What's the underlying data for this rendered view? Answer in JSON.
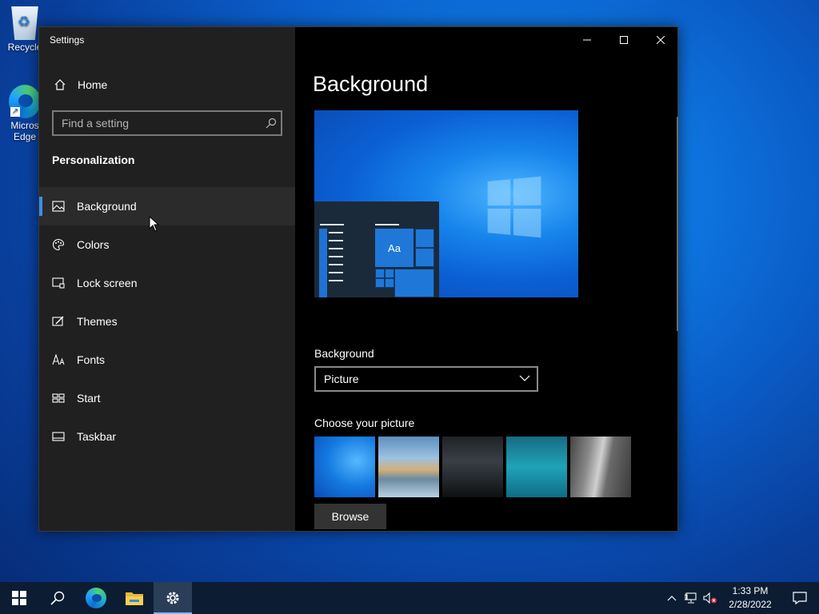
{
  "desktop": {
    "icons": [
      {
        "label": "Recycle",
        "icon": "recycle-bin-icon"
      },
      {
        "label": "Micros Edge",
        "icon": "edge-icon"
      }
    ]
  },
  "window": {
    "title": "Settings",
    "controls": {
      "minimize": "minimize-icon",
      "maximize": "maximize-icon",
      "close": "close-icon"
    }
  },
  "sidebar": {
    "home_label": "Home",
    "search_placeholder": "Find a setting",
    "section_title": "Personalization",
    "items": [
      {
        "label": "Background",
        "icon": "picture-icon",
        "active": true
      },
      {
        "label": "Colors",
        "icon": "palette-icon",
        "active": false
      },
      {
        "label": "Lock screen",
        "icon": "lock-screen-icon",
        "active": false
      },
      {
        "label": "Themes",
        "icon": "themes-icon",
        "active": false
      },
      {
        "label": "Fonts",
        "icon": "fonts-icon",
        "active": false
      },
      {
        "label": "Start",
        "icon": "start-icon",
        "active": false
      },
      {
        "label": "Taskbar",
        "icon": "taskbar-icon",
        "active": false
      }
    ]
  },
  "main": {
    "title": "Background",
    "preview_tile_text": "Aa",
    "background_label": "Background",
    "background_value": "Picture",
    "choose_label": "Choose your picture",
    "browse_label": "Browse"
  },
  "taskbar": {
    "time": "1:33 PM",
    "date": "2/28/2022",
    "apps": [
      "start-icon",
      "search-icon",
      "edge-icon",
      "file-explorer-icon",
      "settings-icon"
    ]
  },
  "colors": {
    "accent": "#3b8ee8",
    "sidebar_bg": "#202020",
    "window_bg": "#000000",
    "taskbar_bg": "#0c1d33"
  }
}
